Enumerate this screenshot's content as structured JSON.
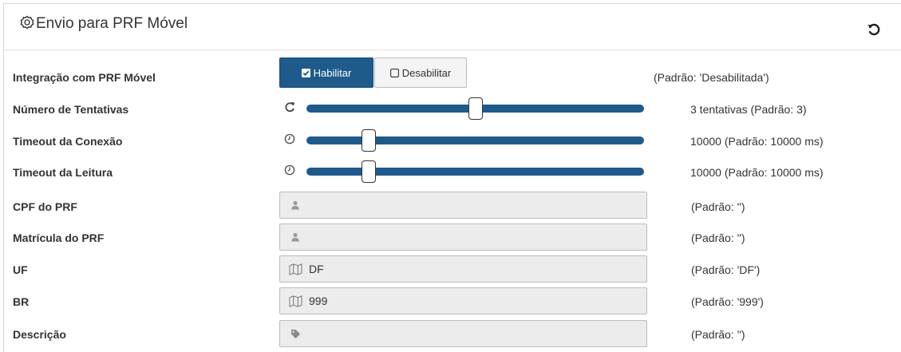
{
  "header": {
    "title": "Envio para PRF Móvel",
    "title_icon": "badge-icon",
    "reset_icon": "undo-icon"
  },
  "rows": {
    "integracao": {
      "label": "Integração com PRF Móvel",
      "enable_label": "Habilitar",
      "disable_label": "Desabilitar",
      "selected": "Habilitar",
      "note": "(Padrão: 'Desabilitada')"
    },
    "tentativas": {
      "label": "Número de Tentativas",
      "icon": "refresh-icon",
      "value": 3,
      "note": "3 tentativas  (Padrão: 3)",
      "level": 0.5
    },
    "timeout_conexao": {
      "label": "Timeout da Conexão",
      "icon": "clock-icon",
      "value": 10000,
      "note": "10000  (Padrão: 10000 ms)",
      "level": 0.17
    },
    "timeout_leitura": {
      "label": "Timeout da Leitura",
      "icon": "clock-icon",
      "value": 10000,
      "note": "10000  (Padrão: 10000 ms)",
      "level": 0.17
    },
    "cpf": {
      "label": "CPF do PRF",
      "icon": "user-icon",
      "value": "",
      "note": "(Padrão: '')"
    },
    "matricula": {
      "label": "Matrícula do PRF",
      "icon": "user-icon",
      "value": "",
      "note": "(Padrão: '')"
    },
    "uf": {
      "label": "UF",
      "icon": "map-icon",
      "value": "DF",
      "note": "(Padrão: 'DF')"
    },
    "br": {
      "label": "BR",
      "icon": "map-icon",
      "value": "999",
      "note": "(Padrão: '999')"
    },
    "descricao": {
      "label": "Descrição",
      "icon": "tag-icon",
      "value": "",
      "note": "(Padrão: '')"
    }
  },
  "colors": {
    "primary": "#1f5a8c",
    "field_bg": "#ececec"
  }
}
